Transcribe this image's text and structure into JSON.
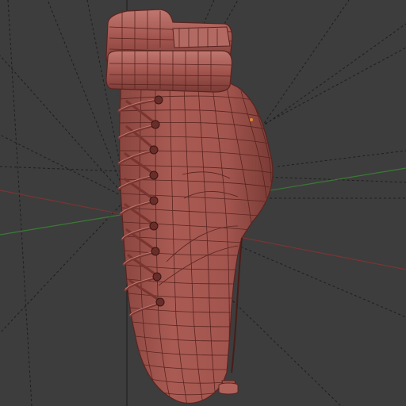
{
  "viewport": {
    "kind": "3d-modeling-viewport",
    "view": "perspective",
    "shading": "solid-with-wireframe-overlay",
    "grid_visible": true
  },
  "colors": {
    "background": "#3d3d3d",
    "grid_line": "#1a1a1a",
    "x_axis": "#8a3a3a",
    "y_axis": "#3f8a3a",
    "mesh_fill": "#a2554e",
    "mesh_shadow": "#7a3b36",
    "mesh_highlight": "#c27a72",
    "wire": "#5a2420",
    "origin_marker": "#e08a2a"
  },
  "scene": {
    "object": "ballet-boot-mesh",
    "components": [
      "boot-shell",
      "ankle-strap-upper",
      "ankle-strap-lower",
      "lacing",
      "heel-tip"
    ]
  }
}
